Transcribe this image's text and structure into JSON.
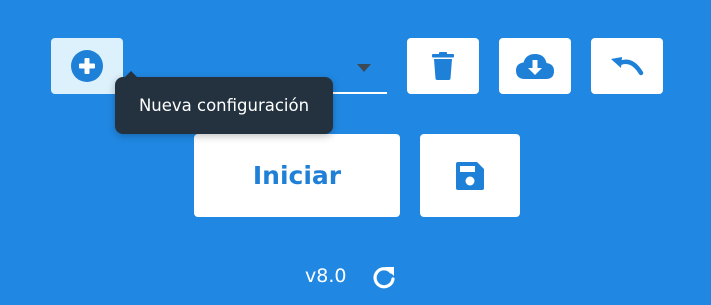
{
  "toolbar": {
    "add_tooltip": "Nueva configuración",
    "select_value": ""
  },
  "actions": {
    "start_label": "Iniciar"
  },
  "footer": {
    "version": "v8.0"
  },
  "icons": {
    "add": "plus-circle-icon",
    "delete": "trash-icon",
    "download": "cloud-download-icon",
    "undo": "undo-icon",
    "save": "floppy-disk-icon",
    "refresh": "refresh-icon",
    "dropdown": "caret-down-icon"
  },
  "colors": {
    "background": "#2088e3",
    "accent": "#1f80d8",
    "tooltip_bg": "#243240",
    "add_button_bg": "#dcf1fb"
  }
}
